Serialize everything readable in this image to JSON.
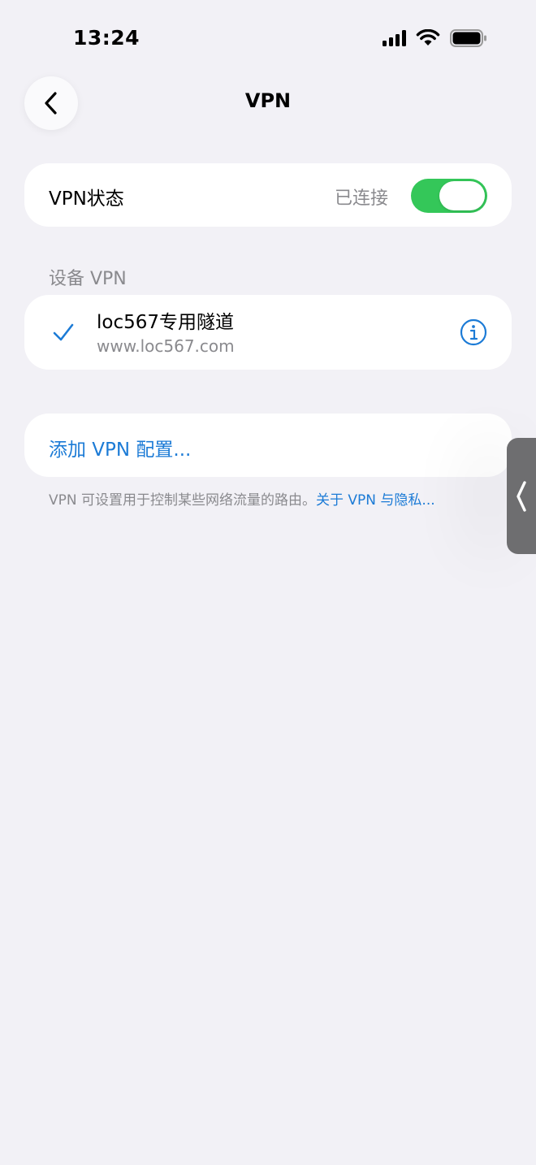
{
  "status_bar": {
    "time": "13:24"
  },
  "header": {
    "title": "VPN",
    "back_icon": "chevron-left-icon"
  },
  "vpn_status": {
    "label": "VPN状态",
    "value": "已连接",
    "toggle_on": true,
    "toggle_color": "#34C759"
  },
  "section": {
    "device_vpn_header": "设备 VPN"
  },
  "vpn_item": {
    "name": "loc567专用隧道",
    "server": "www.loc567.com",
    "selected": true
  },
  "add_vpn": {
    "label": "添加 VPN 配置..."
  },
  "footer": {
    "note": "VPN 可设置用于控制某些网络流量的路由。",
    "link": "关于 VPN 与隐私..."
  },
  "colors": {
    "accent": "#1C7BD6",
    "background": "#F2F1F6",
    "secondary_text": "#8A8A8E"
  }
}
